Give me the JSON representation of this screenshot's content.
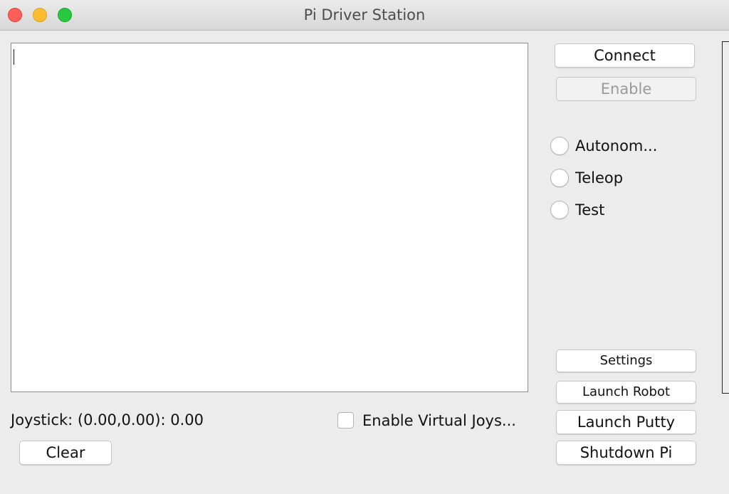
{
  "window": {
    "title": "Pi Driver Station"
  },
  "console": {
    "text": ""
  },
  "controls": {
    "connect_label": "Connect",
    "enable_label": "Enable",
    "modes": [
      {
        "label": "Autonom...",
        "selected": false
      },
      {
        "label": "Teleop",
        "selected": false
      },
      {
        "label": "Test",
        "selected": false
      }
    ]
  },
  "actions": {
    "settings_label": "Settings",
    "launch_robot_label": "Launch Robot",
    "launch_putty_label": "Launch Putty",
    "shutdown_label": "Shutdown Pi"
  },
  "status": {
    "joystick_text": "Joystick: (0.00,0.00): 0.00",
    "virtual_joystick_label": "Enable Virtual Joys...",
    "virtual_joystick_checked": false,
    "clear_label": "Clear"
  }
}
